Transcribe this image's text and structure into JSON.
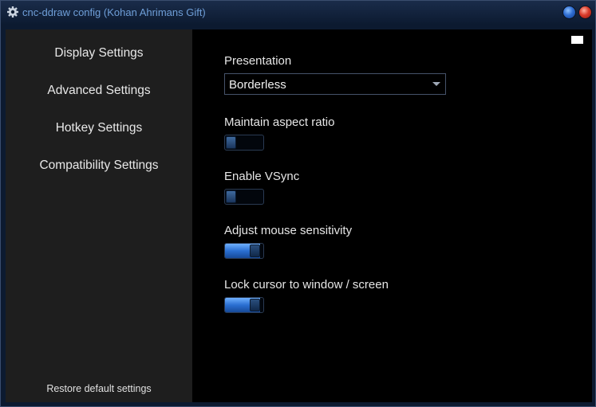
{
  "window": {
    "title": "cnc-ddraw config (Kohan Ahrimans Gift)",
    "accent_color": "#6f9fd8"
  },
  "sidebar": {
    "items": [
      {
        "label": "Display Settings"
      },
      {
        "label": "Advanced Settings"
      },
      {
        "label": "Hotkey Settings"
      },
      {
        "label": "Compatibility Settings"
      }
    ],
    "restore_label": "Restore default settings"
  },
  "settings": {
    "presentation": {
      "label": "Presentation",
      "value": "Borderless"
    },
    "toggles": [
      {
        "label": "Maintain aspect ratio",
        "value": 0
      },
      {
        "label": "Enable VSync",
        "value": 0
      },
      {
        "label": "Adjust mouse sensitivity",
        "value": 1
      },
      {
        "label": "Lock cursor to window / screen",
        "value": 1
      }
    ]
  },
  "icons": {
    "title": "gear-icon",
    "minimize": "minimize-icon",
    "close": "close-icon",
    "dropdown": "chevron-down-icon"
  }
}
